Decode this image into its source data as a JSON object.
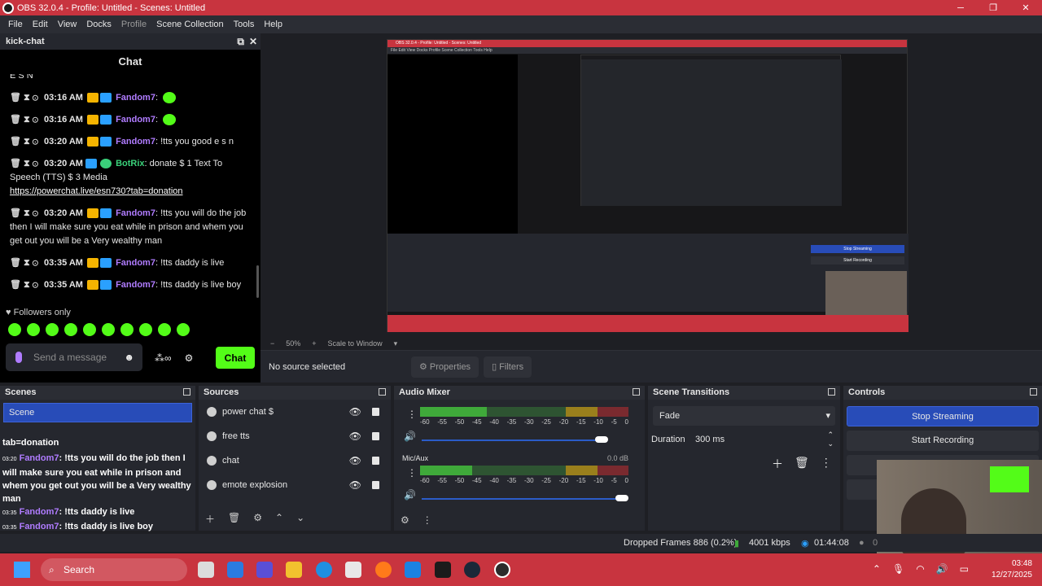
{
  "window": {
    "title": "OBS 32.0.4 - Profile: Untitled - Scenes: Untitled",
    "minimize": "─",
    "maximize": "❐",
    "close": "✕"
  },
  "menu": [
    "File",
    "Edit",
    "View",
    "Docks",
    "Profile",
    "Scene Collection",
    "Tools",
    "Help"
  ],
  "chat_dock": {
    "title": "kick-chat",
    "heading": "Chat",
    "top_fragment": "E S N",
    "messages": [
      {
        "time": "03:16 AM",
        "user": "Fandom7",
        "text": ""
      },
      {
        "time": "03:16 AM",
        "user": "Fandom7",
        "text": ""
      },
      {
        "time": "03:20 AM",
        "user": "Fandom7",
        "text": "!tts you good e s n"
      },
      {
        "time": "03:20 AM",
        "user": "BotRix",
        "text": "donate  $  1 Text To Speech",
        "extra": "(TTS)  $  3 Media",
        "link": "https://powerchat.live/esn730?tab=donation"
      },
      {
        "time": "03:20 AM",
        "user": "Fandom7",
        "text": "!tts you will do the job then I will make sure you eat while in prison and whem you get out you will be a Very wealthy man"
      },
      {
        "time": "03:35 AM",
        "user": "Fandom7",
        "text": "!tts daddy is live"
      },
      {
        "time": "03:35 AM",
        "user": "Fandom7",
        "text": "!tts daddy is live boy"
      }
    ],
    "followers_only": "Followers only",
    "send_placeholder": "Send a message",
    "send_button": "Chat"
  },
  "preview": {
    "zoom": "50%",
    "scale_mode": "Scale to Window",
    "nested": {
      "title": "OBS 32.0.4 - Profile: Untitled - Scenes: Untitled",
      "stop_streaming": "Stop Streaming",
      "start_recording": "Start Recording"
    }
  },
  "source_bar": {
    "no_source": "No source selected",
    "properties": "Properties",
    "filters": "Filters"
  },
  "scenes": {
    "title": "Scenes",
    "items": [
      "Scene"
    ]
  },
  "overlay_chat": {
    "fragment": "tab=donation",
    "lines": [
      {
        "time": "03:20",
        "user": "Fandom7",
        "text": ": !tts you will do the job then I will make sure you eat while in prison and whem you get out you will be a Very wealthy man"
      },
      {
        "time": "03:35",
        "user": "Fandom7",
        "text": ": !tts daddy is live"
      },
      {
        "time": "03:35",
        "user": "Fandom7",
        "text": ": !tts daddy is live boy"
      }
    ]
  },
  "sources": {
    "title": "Sources",
    "items": [
      "power chat $",
      "free tts",
      "chat",
      "emote explosion"
    ]
  },
  "audio_mixer": {
    "title": "Audio Mixer",
    "ticks": [
      "-60",
      "-55",
      "-50",
      "-45",
      "-40",
      "-35",
      "-30",
      "-25",
      "-20",
      "-15",
      "-10",
      "-5",
      "0"
    ],
    "channels": [
      {
        "name": "",
        "db": "",
        "level": 0.32,
        "volume": 0.9
      },
      {
        "name": "Mic/Aux",
        "db": "0.0 dB",
        "level": 0.25,
        "volume": 1.0
      }
    ]
  },
  "transitions": {
    "title": "Scene Transitions",
    "selected": "Fade",
    "duration_label": "Duration",
    "duration": "300 ms"
  },
  "controls": {
    "title": "Controls",
    "stop_streaming": "Stop Streaming",
    "start_recording": "Start Recording"
  },
  "status": {
    "dropped": "Dropped Frames 886 (0.2%)",
    "bitrate": "4001 kbps",
    "stream_time": "01:44:08",
    "rec": "0"
  },
  "taskbar": {
    "search": "Search",
    "time": "03:48",
    "date": "12/27/2025"
  },
  "colors": {
    "accent": "#284cb8",
    "titlebar": "#c8343f",
    "kick_green": "#53fc18"
  }
}
